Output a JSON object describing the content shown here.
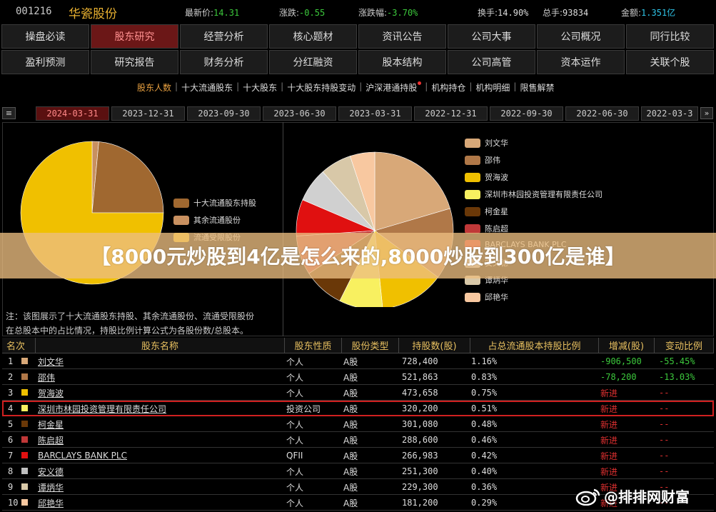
{
  "header": {
    "code": "001216",
    "name": "华瓷股份",
    "quotes": [
      {
        "label": "最新价:",
        "value": "14.31",
        "color": "#3cc83c"
      },
      {
        "label": "涨跌:",
        "value": "-0.55",
        "color": "#3cc83c"
      },
      {
        "label": "涨跌幅:",
        "value": "-3.70%",
        "color": "#3cc83c"
      },
      {
        "label": "换手:",
        "value": "14.90%",
        "color": "#dddddd"
      },
      {
        "label": "总手:",
        "value": "93834",
        "color": "#dddddd"
      },
      {
        "label": "金额:",
        "value": "1.351亿",
        "color": "#2ec4e8"
      }
    ]
  },
  "nav": {
    "row1": [
      "操盘必读",
      "股东研究",
      "经营分析",
      "核心题材",
      "资讯公告",
      "公司大事",
      "公司概况",
      "同行比较"
    ],
    "row2": [
      "盈利预测",
      "研究报告",
      "财务分析",
      "分红融资",
      "股本结构",
      "公司高管",
      "资本运作",
      "关联个股"
    ],
    "active": "股东研究"
  },
  "subtabs": [
    "股东人数",
    "十大流通股东",
    "十大股东",
    "十大股东持股变动",
    "沪深港通持股",
    "机构持仓",
    "机构明细",
    "限售解禁"
  ],
  "dates": {
    "menu_icon": "≡",
    "tabs": [
      "2024-03-31",
      "2023-12-31",
      "2023-09-30",
      "2023-06-30",
      "2023-03-31",
      "2022-12-31",
      "2022-09-30",
      "2022-06-30",
      "2022-03-3"
    ],
    "next_icon": "»"
  },
  "left_legend": [
    {
      "label": "十大流通股东持股",
      "color": "#a06830"
    },
    {
      "label": "其余流通股份",
      "color": "#c89060"
    },
    {
      "label": "流通受限股份",
      "color": "#f0c000"
    }
  ],
  "right_legend": [
    {
      "label": "刘文华",
      "color": "#d8a878"
    },
    {
      "label": "邵伟",
      "color": "#b07848"
    },
    {
      "label": "贺海波",
      "color": "#f0c000"
    },
    {
      "label": "深圳市林园投资管理有限责任公司",
      "color": "#f8f060"
    },
    {
      "label": "柯金星",
      "color": "#6a3808"
    },
    {
      "label": "陈启超",
      "color": "#c03838"
    },
    {
      "label": "BARCLAYS BANK PLC",
      "color": "#e01010"
    },
    {
      "label": "安义德",
      "color": "#c0c0c0"
    },
    {
      "label": "谭炳华",
      "color": "#d8c8a8"
    },
    {
      "label": "邱艳华",
      "color": "#f8c8a0"
    }
  ],
  "note": [
    "注：该图展示了十大流通股东持股、其余流通股份、流通受限股份",
    "在总股本中的占比情况，持股比例计算公式为各股份数/总股本。"
  ],
  "table": {
    "headers": [
      "名次",
      "股东名称",
      "股东性质",
      "股份类型",
      "持股数(股)",
      "占总流通股本持股比例",
      "增减(股)",
      "变动比例"
    ],
    "rows": [
      {
        "rank": "1",
        "name": "刘文华",
        "nature": "个人",
        "type": "A股",
        "shares": "728,400",
        "pct": "1.16%",
        "change": "-906,500",
        "ratio": "-55.45%",
        "color": "#d8a878",
        "change_color": "#3cc83c"
      },
      {
        "rank": "2",
        "name": "邵伟",
        "nature": "个人",
        "type": "A股",
        "shares": "521,863",
        "pct": "0.83%",
        "change": "-78,200",
        "ratio": "-13.03%",
        "color": "#b07848",
        "change_color": "#3cc83c"
      },
      {
        "rank": "3",
        "name": "贺海波",
        "nature": "个人",
        "type": "A股",
        "shares": "473,658",
        "pct": "0.75%",
        "change": "新进",
        "ratio": "--",
        "color": "#f0c000",
        "change_color": "#e03030"
      },
      {
        "rank": "4",
        "name": "深圳市林园投资管理有限责任公司",
        "nature": "投资公司",
        "type": "A股",
        "shares": "320,200",
        "pct": "0.51%",
        "change": "新进",
        "ratio": "--",
        "color": "#f8f060",
        "change_color": "#e03030"
      },
      {
        "rank": "5",
        "name": "柯金星",
        "nature": "个人",
        "type": "A股",
        "shares": "301,080",
        "pct": "0.48%",
        "change": "新进",
        "ratio": "--",
        "color": "#6a3808",
        "change_color": "#e03030"
      },
      {
        "rank": "6",
        "name": "陈启超",
        "nature": "个人",
        "type": "A股",
        "shares": "288,600",
        "pct": "0.46%",
        "change": "新进",
        "ratio": "--",
        "color": "#c03838",
        "change_color": "#e03030"
      },
      {
        "rank": "7",
        "name": "BARCLAYS BANK PLC",
        "nature": "QFII",
        "type": "A股",
        "shares": "266,983",
        "pct": "0.42%",
        "change": "新进",
        "ratio": "--",
        "color": "#e01010",
        "change_color": "#e03030"
      },
      {
        "rank": "8",
        "name": "安义德",
        "nature": "个人",
        "type": "A股",
        "shares": "251,300",
        "pct": "0.40%",
        "change": "新进",
        "ratio": "--",
        "color": "#c0c0c0",
        "change_color": "#e03030"
      },
      {
        "rank": "9",
        "name": "谭炳华",
        "nature": "个人",
        "type": "A股",
        "shares": "229,300",
        "pct": "0.36%",
        "change": "新进",
        "ratio": "--",
        "color": "#d8c8a8",
        "change_color": "#e03030"
      },
      {
        "rank": "10",
        "name": "邱艳华",
        "nature": "个人",
        "type": "A股",
        "shares": "181,200",
        "pct": "0.29%",
        "change": "新进",
        "ratio": "--",
        "color": "#f8c8a0",
        "change_color": "#e03030"
      }
    ]
  },
  "chart_data": [
    {
      "type": "pie",
      "labels": [
        "十大流通股东持股",
        "其余流通股份",
        "流通受限股份"
      ],
      "values": [
        1.5,
        23.5,
        75.0
      ],
      "colors": [
        "#c89060",
        "#a06830",
        "#f0c000"
      ]
    },
    {
      "type": "pie",
      "labels": [
        "刘文华",
        "邵伟",
        "贺海波",
        "深圳市林园投资管理有限责任公司",
        "柯金星",
        "陈启超",
        "BARCLAYS BANK PLC",
        "安义德",
        "谭炳华",
        "邱艳华"
      ],
      "values": [
        728400,
        521863,
        473658,
        320200,
        301080,
        288600,
        266983,
        251300,
        229300,
        181200
      ],
      "colors": [
        "#d8a878",
        "#b07848",
        "#f0c000",
        "#f8f060",
        "#6a3808",
        "#c03838",
        "#e01010",
        "#d0d0d0",
        "#d8c8a8",
        "#f8c8a0"
      ]
    }
  ],
  "banner": "【8000元炒股到4亿是怎么来的,8000炒股到300亿是谁】",
  "watermark": "@排排网财富"
}
